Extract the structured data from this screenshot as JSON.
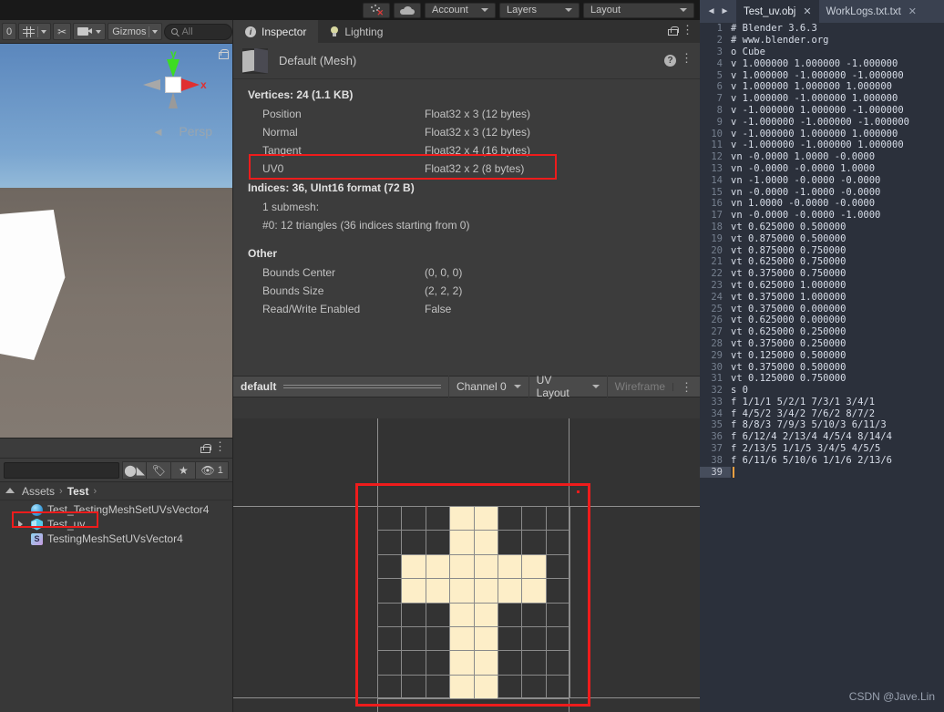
{
  "topbar": {
    "collab_icon": "particles-x-icon",
    "cloud_icon": "cloud-icon",
    "account_label": "Account",
    "layers_label": "Layers",
    "layout_label": "Layout"
  },
  "scene": {
    "toolbar": {
      "count_label": "0",
      "grid_icon": "grid-snap-icon",
      "tools_icon": "tools-icon",
      "camera_icon": "scene-camera-icon",
      "gizmos_label": "Gizmos",
      "search_placeholder": "All",
      "search_value": "",
      "kebab": "⋮"
    },
    "gizmo": {
      "y_label": "y",
      "x_label": "x",
      "persp_label": "Persp",
      "persp_arrow": "◄",
      "y_color": "#3ddc23",
      "x_color": "#e03030"
    },
    "lock_icon": "lock-open-icon"
  },
  "project": {
    "header": {
      "lock_icon": "lock-open-icon",
      "kebab": "⋮"
    },
    "toolbar": {
      "search_value": "",
      "create_icon": "create-asset-icon",
      "label_icon": "tag-icon",
      "favorite_icon": "star-icon",
      "hidden_icon": "eye-hidden-icon",
      "hidden_count": "1"
    },
    "breadcrumb": {
      "root": "Assets",
      "sep": "›",
      "folder": "Test",
      "trailing_sep": "›"
    },
    "assets": [
      {
        "label": "Test_TestingMeshSetUVsVector4",
        "icon": "material-icon",
        "expandable": false,
        "selected": false
      },
      {
        "label": "Test_uv",
        "icon": "model-prefab-icon",
        "expandable": true,
        "selected": true
      },
      {
        "label": "TestingMeshSetUVsVector4",
        "icon": "script-icon",
        "icon_letter": "S",
        "expandable": false,
        "selected": false
      }
    ]
  },
  "inspector": {
    "tabs": [
      {
        "label": "Inspector",
        "icon": "info-icon",
        "active": true
      },
      {
        "label": "Lighting",
        "icon": "lightbulb-icon",
        "active": false
      }
    ],
    "lock_icon": "lock-open-icon",
    "kebab": "⋮",
    "asset_title": "Default (Mesh)",
    "help_icon": "?",
    "vertices_header": "Vertices: 24 (1.1 KB)",
    "vertex_attributes": [
      {
        "name": "Position",
        "format": "Float32 x 3 (12 bytes)",
        "highlighted": false
      },
      {
        "name": "Normal",
        "format": "Float32 x 3 (12 bytes)",
        "highlighted": false
      },
      {
        "name": "Tangent",
        "format": "Float32 x 4 (16 bytes)",
        "highlighted": false
      },
      {
        "name": "UV0",
        "format": "Float32 x 2 (8 bytes)",
        "highlighted": true
      }
    ],
    "indices_header": "Indices: 36, UInt16 format (72 B)",
    "submesh_label": "1 submesh:",
    "submesh_detail": "#0: 12 triangles (36 indices starting from 0)",
    "other_header": "Other",
    "other_rows": [
      {
        "name": "Bounds Center",
        "value": "(0, 0, 0)"
      },
      {
        "name": "Bounds Size",
        "value": "(2, 2, 2)"
      },
      {
        "name": "Read/Write Enabled",
        "value": "False"
      }
    ]
  },
  "preview": {
    "name": "default",
    "channel_label": "Channel 0",
    "mode_label": "UV Layout",
    "wireframe_label": "Wireframe",
    "kebab": "⋮"
  },
  "editor": {
    "nav_back": "◄",
    "nav_forward": "►",
    "tabs": [
      {
        "label": "Test_uv.obj",
        "close": "✕",
        "active": true
      },
      {
        "label": "WorkLogs.txt.txt",
        "close": "✕",
        "active": false
      }
    ],
    "highlight_lines": [
      18,
      31
    ],
    "current_line": 39,
    "lines": [
      {
        "n": 1,
        "text": "# Blender 3.6.3"
      },
      {
        "n": 2,
        "text": "# www.blender.org"
      },
      {
        "n": 3,
        "text": "o Cube"
      },
      {
        "n": 4,
        "text": "v 1.000000 1.000000 -1.000000"
      },
      {
        "n": 5,
        "text": "v 1.000000 -1.000000 -1.000000"
      },
      {
        "n": 6,
        "text": "v 1.000000 1.000000 1.000000"
      },
      {
        "n": 7,
        "text": "v 1.000000 -1.000000 1.000000"
      },
      {
        "n": 8,
        "text": "v -1.000000 1.000000 -1.000000"
      },
      {
        "n": 9,
        "text": "v -1.000000 -1.000000 -1.000000"
      },
      {
        "n": 10,
        "text": "v -1.000000 1.000000 1.000000"
      },
      {
        "n": 11,
        "text": "v -1.000000 -1.000000 1.000000"
      },
      {
        "n": 12,
        "text": "vn -0.0000 1.0000 -0.0000"
      },
      {
        "n": 13,
        "text": "vn -0.0000 -0.0000 1.0000"
      },
      {
        "n": 14,
        "text": "vn -1.0000 -0.0000 -0.0000"
      },
      {
        "n": 15,
        "text": "vn -0.0000 -1.0000 -0.0000"
      },
      {
        "n": 16,
        "text": "vn 1.0000 -0.0000 -0.0000"
      },
      {
        "n": 17,
        "text": "vn -0.0000 -0.0000 -1.0000"
      },
      {
        "n": 18,
        "text": "vt 0.625000 0.500000"
      },
      {
        "n": 19,
        "text": "vt 0.875000 0.500000"
      },
      {
        "n": 20,
        "text": "vt 0.875000 0.750000"
      },
      {
        "n": 21,
        "text": "vt 0.625000 0.750000"
      },
      {
        "n": 22,
        "text": "vt 0.375000 0.750000"
      },
      {
        "n": 23,
        "text": "vt 0.625000 1.000000"
      },
      {
        "n": 24,
        "text": "vt 0.375000 1.000000"
      },
      {
        "n": 25,
        "text": "vt 0.375000 0.000000"
      },
      {
        "n": 26,
        "text": "vt 0.625000 0.000000"
      },
      {
        "n": 27,
        "text": "vt 0.625000 0.250000"
      },
      {
        "n": 28,
        "text": "vt 0.375000 0.250000"
      },
      {
        "n": 29,
        "text": "vt 0.125000 0.500000"
      },
      {
        "n": 30,
        "text": "vt 0.375000 0.500000"
      },
      {
        "n": 31,
        "text": "vt 0.125000 0.750000"
      },
      {
        "n": 32,
        "text": "s 0"
      },
      {
        "n": 33,
        "text": "f 1/1/1 5/2/1 7/3/1 3/4/1"
      },
      {
        "n": 34,
        "text": "f 4/5/2 3/4/2 7/6/2 8/7/2"
      },
      {
        "n": 35,
        "text": "f 8/8/3 7/9/3 5/10/3 6/11/3"
      },
      {
        "n": 36,
        "text": "f 6/12/4 2/13/4 4/5/4 8/14/4"
      },
      {
        "n": 37,
        "text": "f 2/13/5 1/1/5 3/4/5 4/5/5"
      },
      {
        "n": 38,
        "text": "f 6/11/6 5/10/6 1/1/6 2/13/6"
      },
      {
        "n": 39,
        "text": ""
      }
    ]
  },
  "uv_layout": {
    "grid_cols": 8,
    "grid_rows": 8,
    "fill_color": "#fdeec8",
    "empty_color": "#333333",
    "cross_cells": [
      {
        "col": 3,
        "row": 0,
        "w": 2,
        "h": 2
      },
      {
        "col": 1,
        "row": 2,
        "w": 6,
        "h": 2
      },
      {
        "col": 3,
        "row": 4,
        "w": 2,
        "h": 4
      }
    ]
  },
  "watermark": "CSDN @Jave.Lin"
}
